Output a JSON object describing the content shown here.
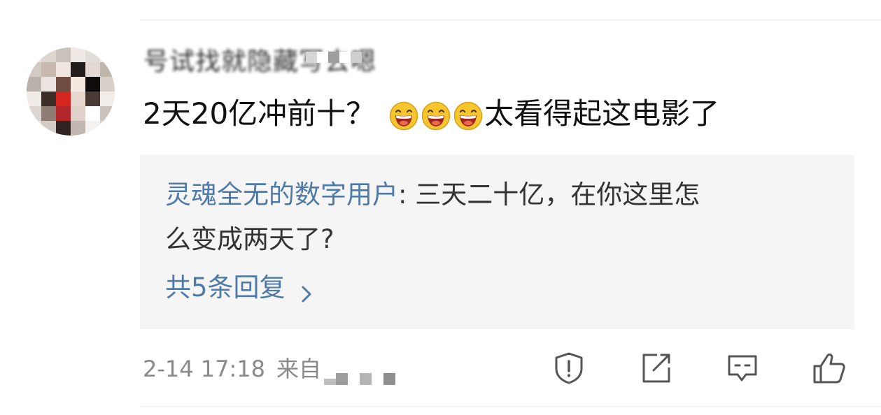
{
  "comment": {
    "username": "号试找就隐藏写去嗯",
    "text_before_emoji": "2天20亿冲前十？",
    "emoji_name": "laughing-face-emoji",
    "emoji_count": 3,
    "text_after_emoji": "太看得起这电影了"
  },
  "reply": {
    "author": "灵魂全无的数字用户",
    "separator": ": ",
    "text_line1": "三天二十亿，在你这里怎",
    "text_line2": "么变成两天了?",
    "more_label": "共5条回复"
  },
  "meta": {
    "timestamp": "2-14 17:18",
    "source_label": "来自"
  },
  "actions": [
    {
      "icon": "report-icon"
    },
    {
      "icon": "share-icon"
    },
    {
      "icon": "comment-icon"
    },
    {
      "icon": "like-icon"
    }
  ],
  "colors": {
    "link_blue": "#4f7aa8",
    "reply_bg": "#f5f5f5",
    "meta_gray": "#8a8a8a",
    "icon_gray": "#555555"
  }
}
